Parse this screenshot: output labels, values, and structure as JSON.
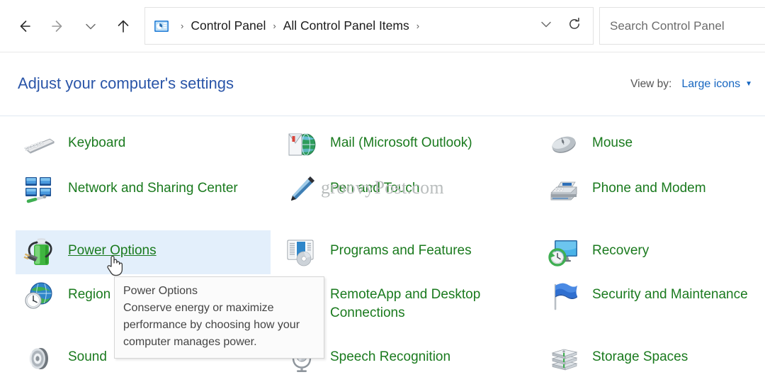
{
  "toolbar": {
    "back_icon": "arrow-left-icon",
    "forward_icon": "arrow-right-icon",
    "recent_icon": "chevron-down-icon",
    "up_icon": "arrow-up-icon",
    "app_icon": "control-panel-icon",
    "breadcrumbs": [
      "Control Panel",
      "All Control Panel Items"
    ],
    "breadcrumb_separator": "›",
    "dropdown_icon": "chevron-down-icon",
    "refresh_icon": "refresh-icon",
    "search": {
      "placeholder": "Search Control Panel",
      "value": ""
    }
  },
  "header": {
    "title": "Adjust your computer's settings",
    "view_by_label": "View by:",
    "view_by_value": "Large icons",
    "view_by_caret": "▼"
  },
  "items": [
    {
      "label": "Keyboard",
      "icon": "keyboard-icon",
      "col": 1,
      "row": 1,
      "hovered": false
    },
    {
      "label": "Mail (Microsoft Outlook)",
      "icon": "mail-icon",
      "col": 2,
      "row": 1,
      "hovered": false
    },
    {
      "label": "Mouse",
      "icon": "mouse-icon",
      "col": 3,
      "row": 1,
      "hovered": false
    },
    {
      "label": "Network and Sharing Center",
      "icon": "network-icon",
      "col": 1,
      "row": 2,
      "hovered": false
    },
    {
      "label": "Pen and Touch",
      "icon": "pen-icon",
      "col": 2,
      "row": 2,
      "hovered": false
    },
    {
      "label": "Phone and Modem",
      "icon": "phone-modem-icon",
      "col": 3,
      "row": 2,
      "hovered": false
    },
    {
      "label": "Power Options",
      "icon": "power-battery-icon",
      "col": 1,
      "row": 3,
      "hovered": true
    },
    {
      "label": "Programs and Features",
      "icon": "programs-icon",
      "col": 2,
      "row": 3,
      "hovered": false
    },
    {
      "label": "Recovery",
      "icon": "recovery-icon",
      "col": 3,
      "row": 3,
      "hovered": false
    },
    {
      "label": "Region",
      "icon": "region-globe-icon",
      "col": 1,
      "row": 4,
      "hovered": false
    },
    {
      "label": "RemoteApp and Desktop Connections",
      "icon": "remoteapp-icon",
      "col": 2,
      "row": 4,
      "hovered": false
    },
    {
      "label": "Security and Maintenance",
      "icon": "security-flag-icon",
      "col": 3,
      "row": 4,
      "hovered": false
    },
    {
      "label": "Sound",
      "icon": "speaker-icon",
      "col": 1,
      "row": 5,
      "hovered": false
    },
    {
      "label": "Speech Recognition",
      "icon": "microphone-icon",
      "col": 2,
      "row": 5,
      "hovered": false
    },
    {
      "label": "Storage Spaces",
      "icon": "storage-icon",
      "col": 3,
      "row": 5,
      "hovered": false
    }
  ],
  "tooltip": {
    "title": "Power Options",
    "body": "Conserve energy or maximize performance by choosing how your computer manages power."
  },
  "watermark": {
    "text": "groovyPost.com"
  },
  "cursor": {
    "icon": "hand-pointer-cursor"
  },
  "colors": {
    "link_green": "#1a7a1e",
    "title_blue": "#2a55a8",
    "accent_blue": "#1565c0",
    "hover_highlight": "#e3effb",
    "tooltip_bg": "#fbfbfb"
  }
}
